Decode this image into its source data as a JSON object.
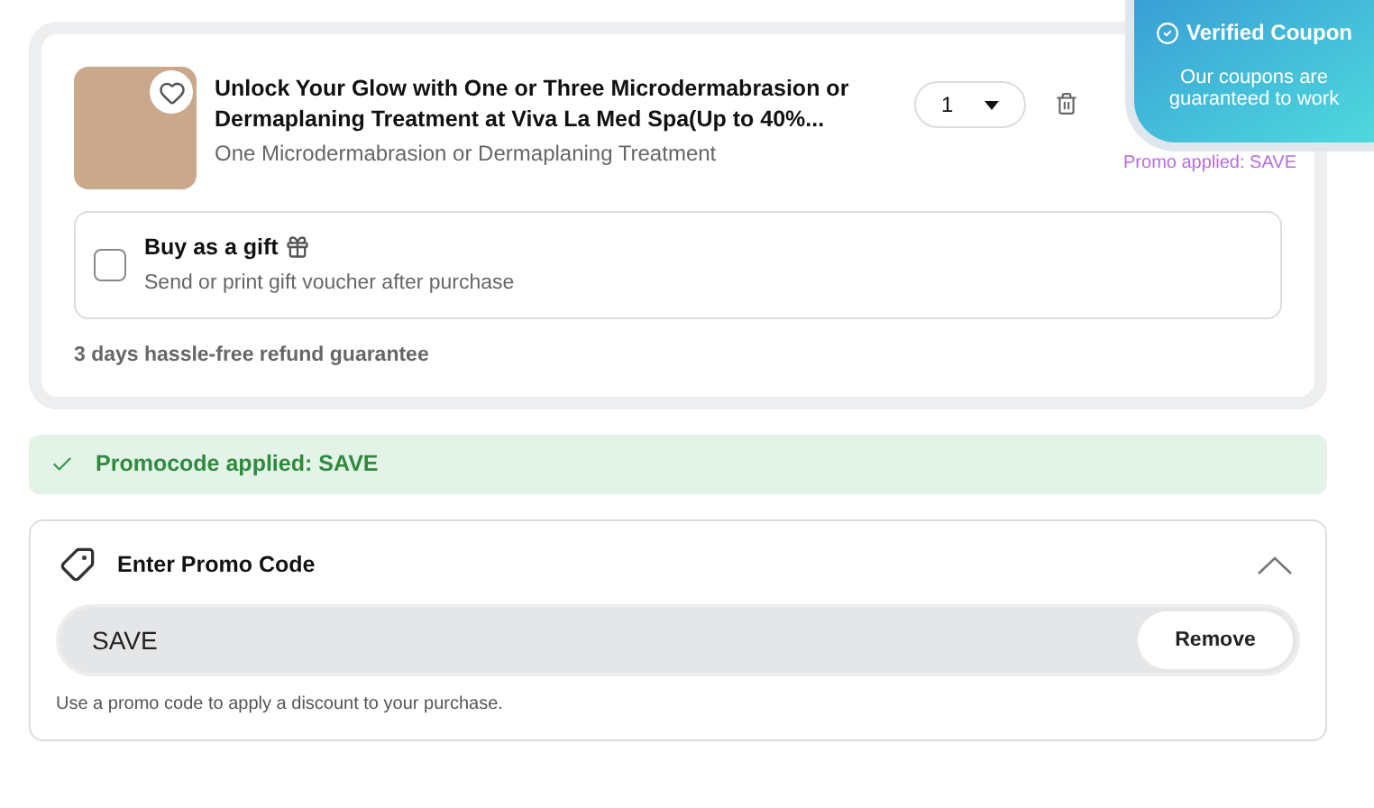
{
  "item": {
    "title": "Unlock Your Glow with One or Three Microdermabrasion or Dermaplaning Treatment at Viva La Med Spa(Up to 40%...",
    "option": "One Microdermabrasion or Dermaplaning Treatment",
    "favorite": false,
    "quantity": "1",
    "promo_note": "Promo applied: SAVE"
  },
  "gift": {
    "label": "Buy as a gift",
    "hint": "Send or print gift voucher after purchase",
    "checked": false
  },
  "refund_note": "3 days hassle-free refund guarantee",
  "promo_banner": "Promocode applied: SAVE",
  "promo_section": {
    "title": "Enter Promo Code",
    "expanded": true,
    "value": "SAVE",
    "button": "Remove",
    "help": "Use a promo code to apply a discount to your purchase."
  },
  "verified_badge": {
    "title": "Verified Coupon",
    "text": "Our coupons are guaranteed to work"
  }
}
